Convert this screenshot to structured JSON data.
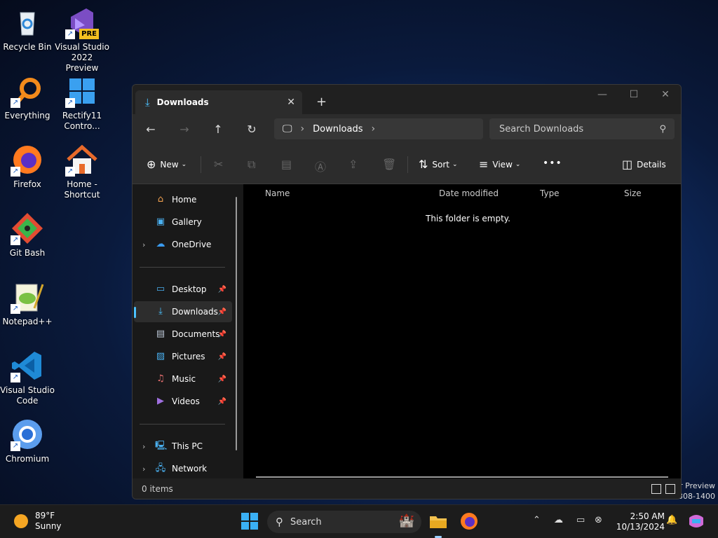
{
  "desktop": {
    "icons": [
      {
        "label": "Recycle Bin"
      },
      {
        "label": "Visual Studio 2022 Preview"
      },
      {
        "label": "Everything"
      },
      {
        "label": "Rectify11 Contro..."
      },
      {
        "label": "Firefox"
      },
      {
        "label": "Home - Shortcut"
      },
      {
        "label": "Git Bash"
      },
      {
        "label": "Notepad++"
      },
      {
        "label": "Visual Studio Code"
      },
      {
        "label": "Chromium"
      }
    ],
    "pre_badge": "PRE",
    "watermark_line1": "r Preview",
    "watermark_line2": "308-1400"
  },
  "explorer": {
    "tab_title": "Downloads",
    "address_current": "Downloads",
    "search_placeholder": "Search Downloads",
    "toolbar": {
      "new_label": "New",
      "sort_label": "Sort",
      "view_label": "View",
      "more_label": "•••",
      "details_label": "Details"
    },
    "sidebar": {
      "home": "Home",
      "gallery": "Gallery",
      "onedrive": "OneDrive",
      "desktop": "Desktop",
      "downloads": "Downloads",
      "documents": "Documents",
      "pictures": "Pictures",
      "music": "Music",
      "videos": "Videos",
      "thispc": "This PC",
      "network": "Network"
    },
    "columns": {
      "name": "Name",
      "date": "Date modified",
      "type": "Type",
      "size": "Size"
    },
    "empty_message": "This folder is empty.",
    "status": "0 items"
  },
  "taskbar": {
    "temperature": "89°F",
    "condition": "Sunny",
    "search_label": "Search",
    "time": "2:50 AM",
    "date": "10/13/2024"
  },
  "colors": {
    "accent": "#4cc2ff",
    "window_bg": "#202020",
    "file_area_bg": "#000000"
  }
}
